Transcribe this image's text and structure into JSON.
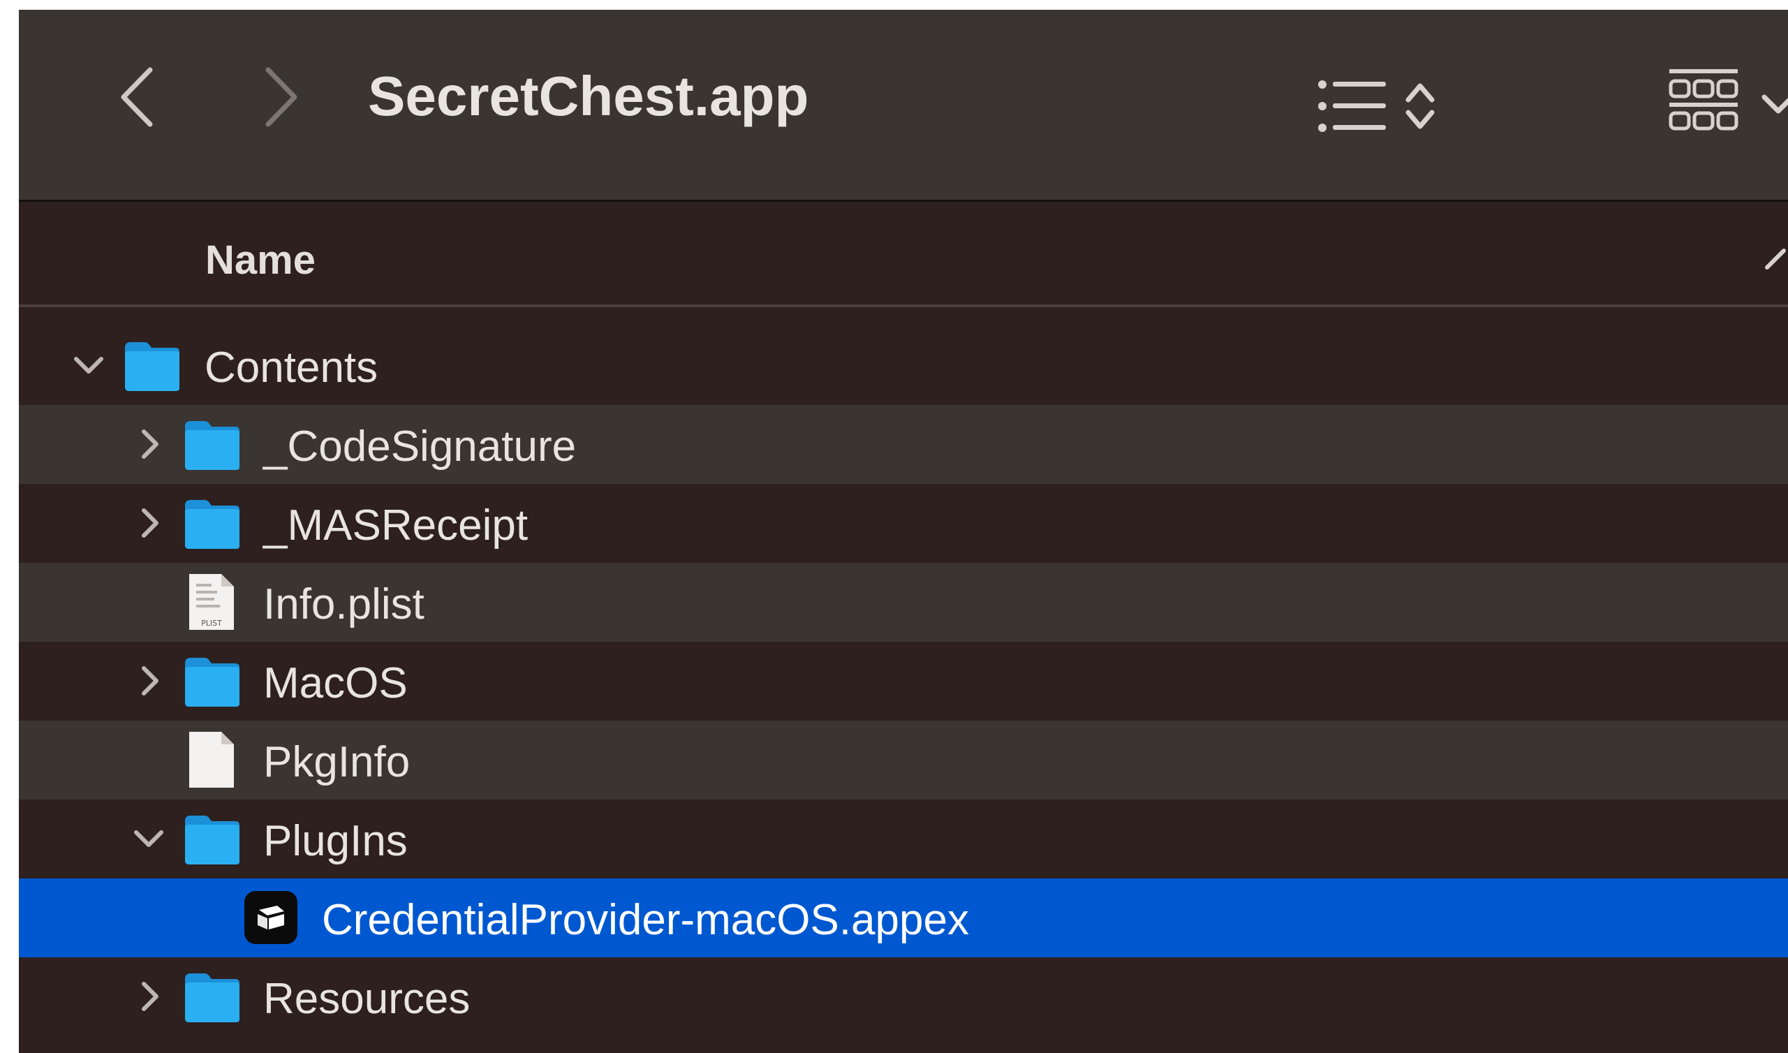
{
  "window": {
    "title": "SecretChest.app",
    "colors": {
      "toolbar": "#3b3531",
      "list_bg": "#2d201e",
      "alt_row": "#3b3531",
      "selection": "#0058d0",
      "folder": "#1ea0e8"
    }
  },
  "toolbar": {
    "back_icon": "chevron-left-icon",
    "forward_icon": "chevron-right-icon",
    "view_icon": "list-view-icon",
    "group_icon": "gallery-grid-icon"
  },
  "columns": {
    "name": "Name"
  },
  "rows": [
    {
      "label": "Contents",
      "icon": "folder-icon",
      "disclosure": "expanded"
    },
    {
      "label": "_CodeSignature",
      "icon": "folder-icon",
      "disclosure": "collapsed"
    },
    {
      "label": "_MASReceipt",
      "icon": "folder-icon",
      "disclosure": "collapsed"
    },
    {
      "label": "Info.plist",
      "icon": "plist-file-icon",
      "disclosure": "none",
      "badge": "PLIST"
    },
    {
      "label": "MacOS",
      "icon": "folder-icon",
      "disclosure": "collapsed"
    },
    {
      "label": "PkgInfo",
      "icon": "document-icon",
      "disclosure": "none"
    },
    {
      "label": "PlugIns",
      "icon": "folder-icon",
      "disclosure": "expanded"
    },
    {
      "label": "CredentialProvider-macOS.appex",
      "icon": "app-extension-icon",
      "disclosure": "none",
      "selected": true
    },
    {
      "label": "Resources",
      "icon": "folder-icon",
      "disclosure": "collapsed"
    }
  ]
}
